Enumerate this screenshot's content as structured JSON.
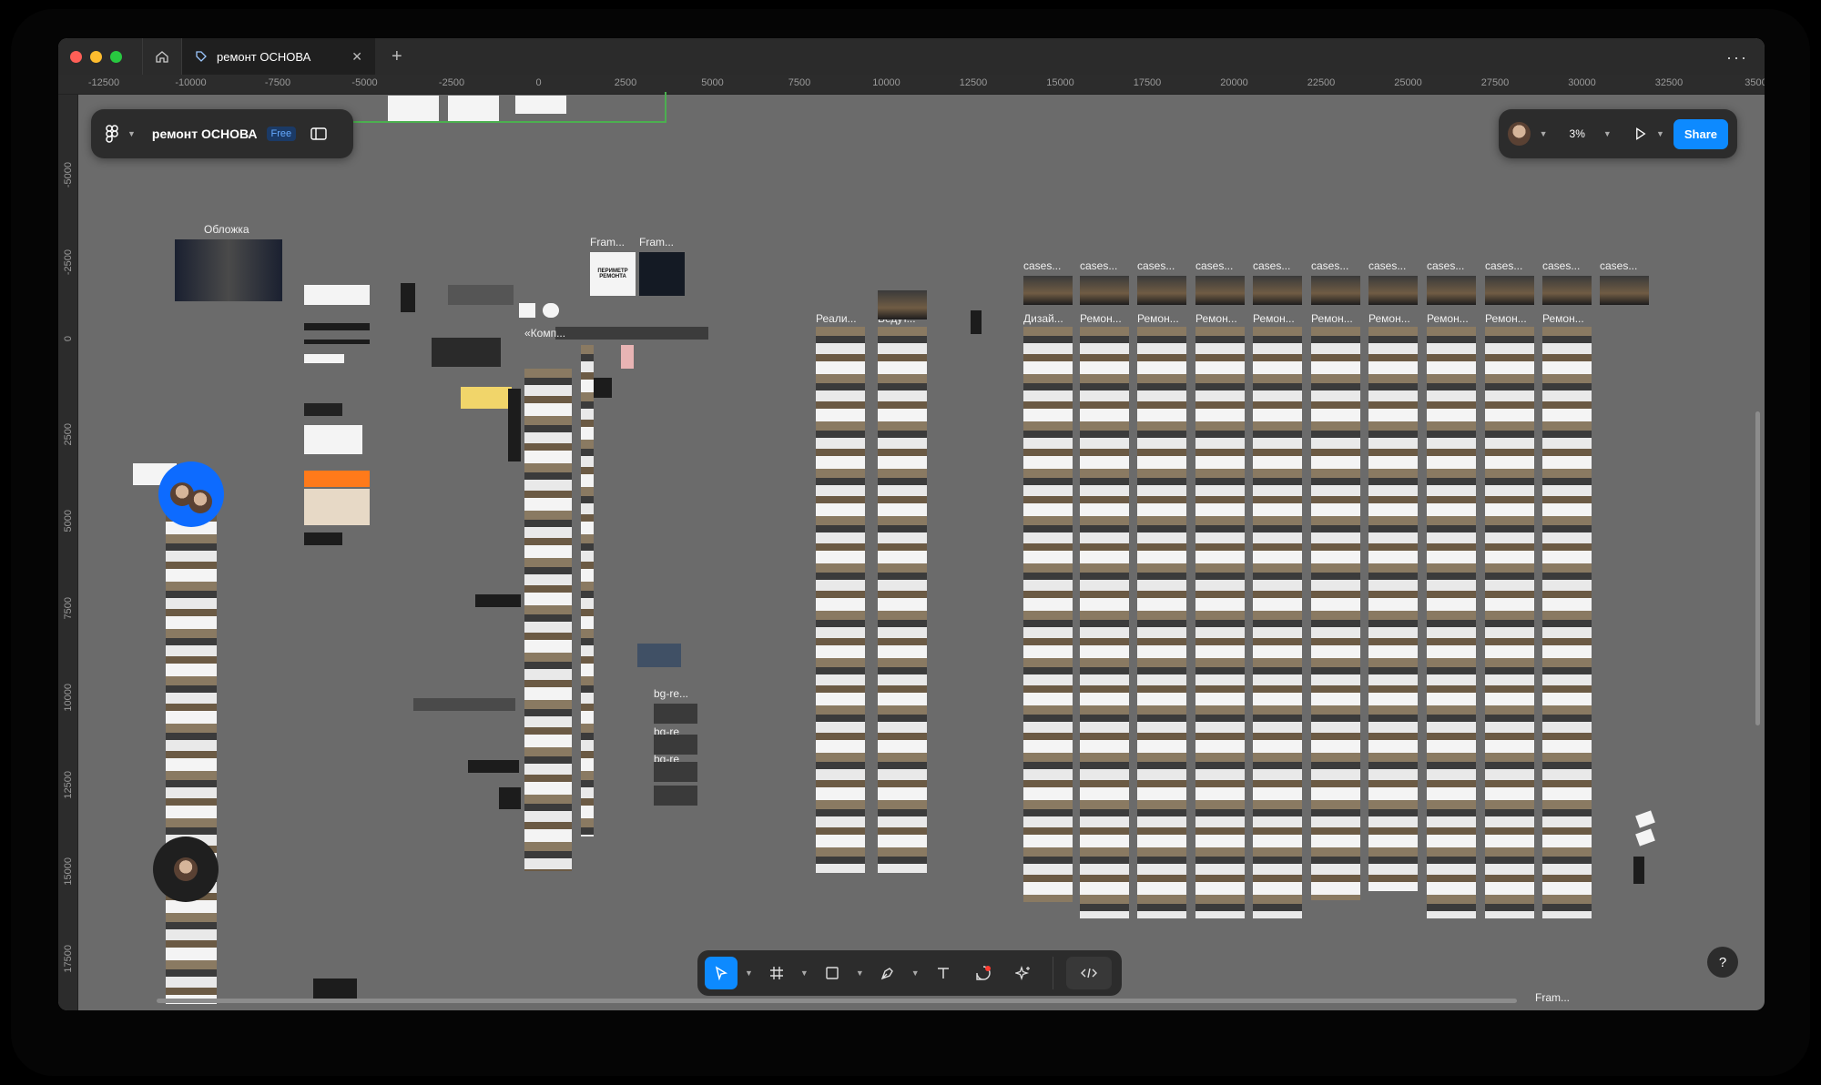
{
  "tab": {
    "title": "ремонт ОСНОВА"
  },
  "file": {
    "name": "ремонт ОСНОВА",
    "plan": "Free"
  },
  "zoom": {
    "value": "3%"
  },
  "share": {
    "label": "Share"
  },
  "ruler_x": [
    "-12500",
    "-10000",
    "-7500",
    "-5000",
    "-2500",
    "0",
    "2500",
    "5000",
    "7500",
    "10000",
    "12500",
    "15000",
    "17500",
    "20000",
    "22500",
    "25000",
    "27500",
    "30000",
    "32500",
    "3500"
  ],
  "ruler_y": [
    "-5000",
    "-2500",
    "0",
    "2500",
    "5000",
    "7500",
    "10000",
    "12500",
    "15000",
    "17500"
  ],
  "labels": {
    "cover": "Обложка",
    "frame1": "Fram...",
    "frame2": "Fram...",
    "komp": "«Комп...",
    "reali": "Реали...",
    "vedut": "Ведут...",
    "bgre": "bg-re...",
    "bgre2": "bg-re",
    "bgre3": "bg-re",
    "frame_bottom": "Fram...",
    "dizai": "Дизай...",
    "remon": "Ремон...",
    "cases": "cases...",
    "perimeter": "ПЕРИМЕТР РЕМОНТА",
    "help": "?"
  },
  "colors": {
    "accent": "#0d8aff",
    "canvas": "#6b6b6b",
    "toolbar": "#2c2c2c"
  }
}
